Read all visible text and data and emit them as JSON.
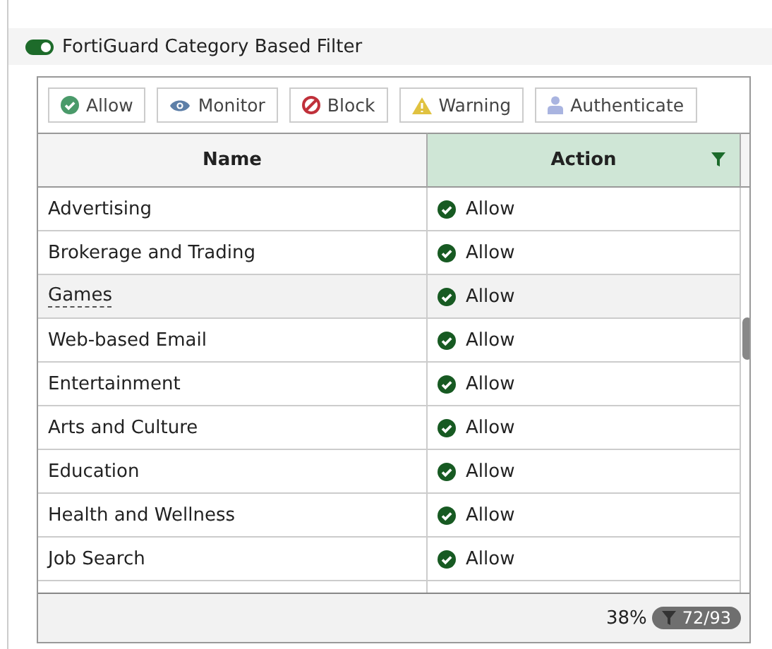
{
  "section": {
    "title": "FortiGuard Category Based Filter",
    "enabled": true
  },
  "toolbar": [
    {
      "kind": "allow",
      "label": "Allow"
    },
    {
      "kind": "monitor",
      "label": "Monitor"
    },
    {
      "kind": "block",
      "label": "Block"
    },
    {
      "kind": "warning",
      "label": "Warning"
    },
    {
      "kind": "authenticate",
      "label": "Authenticate"
    }
  ],
  "table": {
    "columns": [
      {
        "label": "Name",
        "filtered": false
      },
      {
        "label": "Action",
        "filtered": true
      }
    ],
    "rows": [
      {
        "name": "Advertising",
        "action": "Allow",
        "selected": false
      },
      {
        "name": "Brokerage and Trading",
        "action": "Allow",
        "selected": false
      },
      {
        "name": "Games",
        "action": "Allow",
        "selected": true
      },
      {
        "name": "Web-based Email",
        "action": "Allow",
        "selected": false
      },
      {
        "name": "Entertainment",
        "action": "Allow",
        "selected": false
      },
      {
        "name": "Arts and Culture",
        "action": "Allow",
        "selected": false
      },
      {
        "name": "Education",
        "action": "Allow",
        "selected": false
      },
      {
        "name": "Health and Wellness",
        "action": "Allow",
        "selected": false
      },
      {
        "name": "Job Search",
        "action": "Allow",
        "selected": false
      }
    ]
  },
  "footer": {
    "percent": "38%",
    "count": "72/93"
  }
}
